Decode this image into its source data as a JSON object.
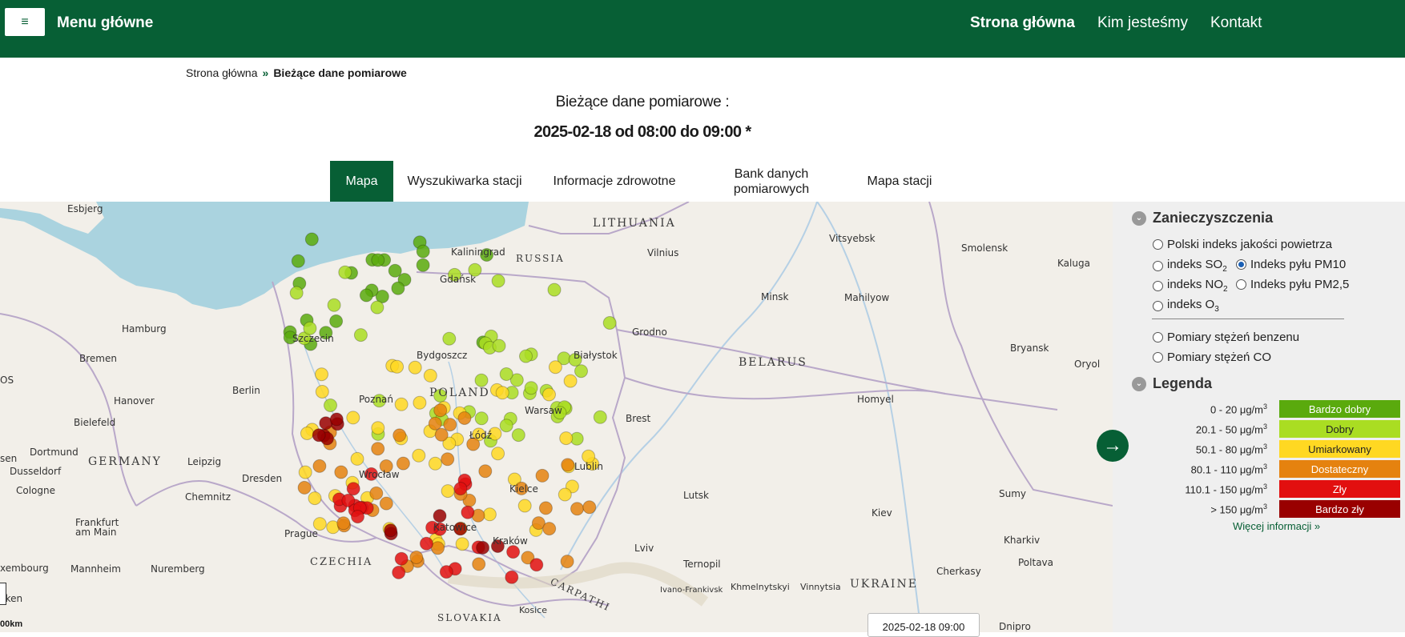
{
  "header": {
    "menu_label": "Menu główne",
    "nav": [
      {
        "label": "Strona główna",
        "active": true
      },
      {
        "label": "Kim jesteśmy",
        "active": false
      },
      {
        "label": "Kontakt",
        "active": false
      }
    ]
  },
  "breadcrumb": {
    "home": "Strona główna",
    "sep": "»",
    "current": "Bieżące dane pomiarowe"
  },
  "page": {
    "title": "Bieżące dane pomiarowe :",
    "period": "2025-02-18 od 08:00 do 09:00 *"
  },
  "tabs": [
    {
      "label": "Mapa",
      "active": true
    },
    {
      "label": "Wyszukiwarka stacji",
      "active": false
    },
    {
      "label": "Informacje zdrowotne",
      "active": false
    },
    {
      "label": "Bank danych pomiarowych",
      "active": false
    },
    {
      "label": "Mapa stacji",
      "active": false
    }
  ],
  "map": {
    "date_label": "2025-02-18 09:00",
    "scale_label": "00km",
    "labels": {
      "esbjerg": "Esbjerg",
      "lithuania": "LITHUANIA",
      "vitsyebsk": "Vitsyebsk",
      "smolensk": "Smolensk",
      "kaluga": "Kaluga",
      "kaliningrad": "Kaliningrad",
      "russia": "RUSSIA",
      "vilnius": "Vilnius",
      "gdansk": "Gdańsk",
      "minsk": "Minsk",
      "mahilyow": "Mahilyow",
      "hamburg": "Hamburg",
      "szczecin": "Szczecin",
      "grodno": "Grodno",
      "bryansk": "Bryansk",
      "bremen": "Bremen",
      "bydgoszcz": "Bydgoszcz",
      "bialystok": "Białystok",
      "belarus": "BELARUS",
      "oryol": "Oryol",
      "berlin": "Berlin",
      "poznan": "Poznań",
      "poland": "POLAND",
      "hanover": "Hanover",
      "warsaw": "Warsaw",
      "homyel": "Homyel",
      "bielefeld": "Bielefeld",
      "brest": "Brest",
      "lodz": "Łódź",
      "dortmund": "Dortmund",
      "leipzig": "Leipzig",
      "germany": "GERMANY",
      "dusseldorf": "Dusseldorf",
      "wroclaw": "Wrocław",
      "lublin": "Lublin",
      "cologne": "Cologne",
      "dresden": "Dresden",
      "chemnitz": "Chemnitz",
      "kielce": "Kielce",
      "lutsk": "Lutsk",
      "sumy": "Sumy",
      "frankfurt": "Frankfurt am Main",
      "prague": "Prague",
      "katowice": "Katowice",
      "krakow": "Kraków",
      "kiev": "Kiev",
      "kharkiv": "Kharkiv",
      "czechia": "CZECHIA",
      "lviv": "Lviv",
      "luxembourg": "xembourg",
      "mannheim": "Mannheim",
      "nuremberg": "Nuremberg",
      "ternopil": "Ternopil",
      "poltava": "Poltava",
      "cherkasy": "Cherkasy",
      "ukraine": "UKRAINE",
      "ivano": "Ivano-Frankivsk",
      "khmelnytskyi": "Khmelnytskyi",
      "vinnytsia": "Vinnytsia",
      "kosice": "Kosice",
      "slovakia": "SLOVAKIA",
      "carpathians": "CARPATHI",
      "dnipro": "Dnipro",
      "saarbrucken": "cken",
      "os": "OS",
      "sen": "sen"
    }
  },
  "panel": {
    "pollution_heading": "Zanieczyszczenia",
    "options": {
      "polish_index": "Polski indeks jakości powietrza",
      "so2": "indeks SO",
      "so2_sub": "2",
      "pm10": "Indeks pyłu PM10",
      "no2": "indeks NO",
      "no2_sub": "2",
      "pm25": "Indeks pyłu PM2,5",
      "o3": "indeks O",
      "o3_sub": "3",
      "benzene": "Pomiary stężeń benzenu",
      "co": "Pomiary stężeń CO"
    },
    "selected": "pm10",
    "legend_heading": "Legenda",
    "unit": "μg/m",
    "unit_sup": "3",
    "legend": [
      {
        "range": "0 - 20",
        "label": "Bardzo dobry",
        "color": "#5aaa0d"
      },
      {
        "range": "20.1 - 50",
        "label": "Dobry",
        "color": "#aadd22"
      },
      {
        "range": "50.1 - 80",
        "label": "Umiarkowany",
        "color": "#ffd822"
      },
      {
        "range": "80.1 - 110",
        "label": "Dostateczny",
        "color": "#e5820f"
      },
      {
        "range": "110.1 - 150",
        "label": "Zły",
        "color": "#e20f0f"
      },
      {
        "range": "> 150",
        "label": "Bardzo zły",
        "color": "#990000"
      }
    ],
    "more_info": "Więcej informacji »"
  },
  "stations_by_level": {
    "very_good": 24,
    "good": 48,
    "moderate": 52,
    "sufficient": 40,
    "bad": 26,
    "very_bad": 12
  }
}
